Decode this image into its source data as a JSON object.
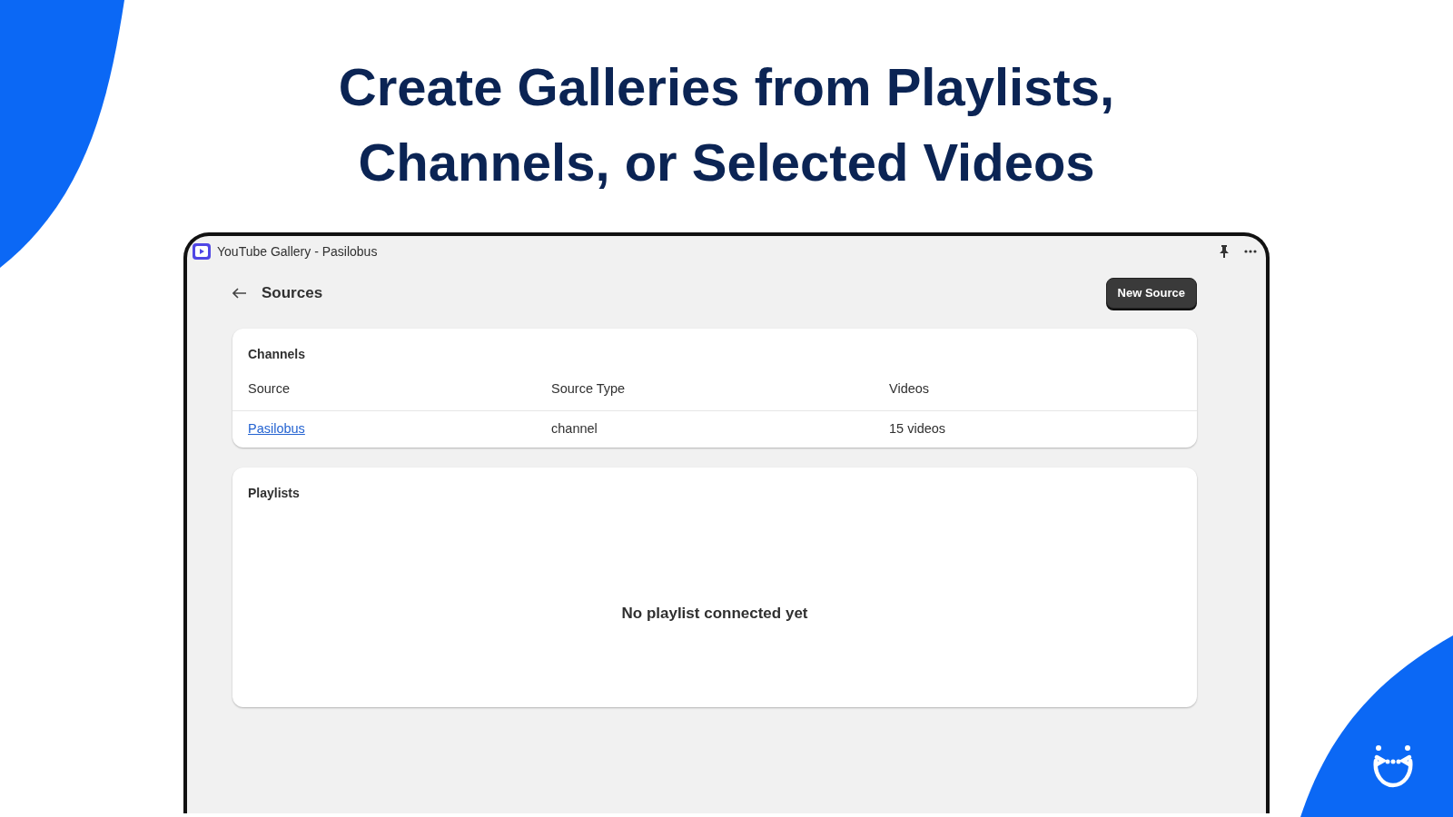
{
  "headline": [
    "Create Galleries from Playlists,",
    "Channels, or Selected Videos"
  ],
  "window": {
    "title": "YouTube Gallery - Pasilobus"
  },
  "page": {
    "title": "Sources",
    "primary_button": "New Source"
  },
  "sections": [
    {
      "kind": "table",
      "title": "Channels",
      "columns": [
        "Source",
        "Source Type",
        "Videos"
      ],
      "rows": [
        [
          "Pasilobus",
          "channel",
          "15 videos"
        ]
      ]
    },
    {
      "kind": "empty",
      "title": "Playlists",
      "empty_message": "No playlist connected yet"
    }
  ]
}
